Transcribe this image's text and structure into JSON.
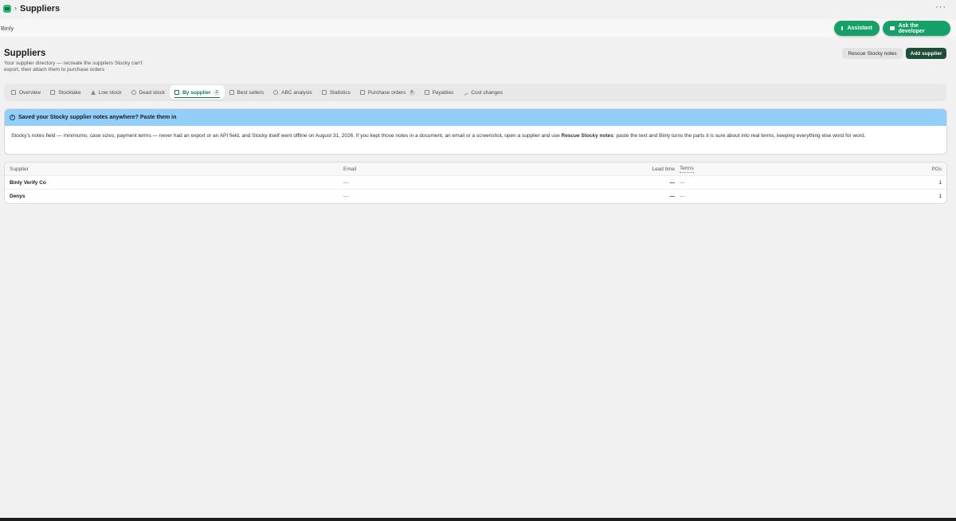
{
  "window": {
    "title": "Suppliers",
    "more_icon": "ellipsis-icon"
  },
  "appbar": {
    "app_name": "Binly",
    "assistant_label": "Assistant",
    "developer_label": "Ask the developer"
  },
  "page": {
    "title": "Suppliers",
    "subtitle": "Your supplier directory — recreate the suppliers Stocky can't export, then attach them to purchase orders",
    "secondary_action": "Rescue Stocky notes",
    "primary_action": "Add supplier"
  },
  "tabs": [
    {
      "label": "Overview",
      "icon": "grid-icon"
    },
    {
      "label": "Stocktake",
      "icon": "grid-icon"
    },
    {
      "label": "Low stock",
      "icon": "warning-icon"
    },
    {
      "label": "Dead stock",
      "icon": "clock-icon"
    },
    {
      "label": "By supplier",
      "icon": "store-icon",
      "badge": "2",
      "active": true
    },
    {
      "label": "Best sellers",
      "icon": "chart-icon"
    },
    {
      "label": "ABC analysis",
      "icon": "pie-icon"
    },
    {
      "label": "Statistics",
      "icon": "line-chart-icon"
    },
    {
      "label": "Purchase orders",
      "icon": "document-icon",
      "badge": "5"
    },
    {
      "label": "Payables",
      "icon": "wallet-icon"
    },
    {
      "label": "Cost changes",
      "icon": "trend-icon"
    }
  ],
  "callout": {
    "title": "Saved your Stocky supplier notes anywhere? Paste them in",
    "body_before": "Stocky's notes field — minimums, case sizes, payment terms — never had an export or an API field, and Stocky itself went offline on August 31, 2026. If you kept those notes in a document, an email or a screenshot, open a supplier and use ",
    "body_strong": "Rescue Stocky notes",
    "body_after": ": paste the text and Binly turns the parts it is sure about into real terms, keeping everything else word for word."
  },
  "table": {
    "headers": {
      "supplier": "Supplier",
      "email": "Email",
      "lead_time": "Lead time",
      "terms": "Terms",
      "pos": "POs"
    },
    "rows": [
      {
        "supplier": "Binly Verify Co",
        "email": "—",
        "lead_time": "—",
        "terms": "—",
        "pos": "1"
      },
      {
        "supplier": "Denys",
        "email": "—",
        "lead_time": "—",
        "terms": "—",
        "pos": "1"
      }
    ]
  },
  "colors": {
    "accent": "#16a067",
    "primary_dark": "#1f4d3a",
    "callout": "#93cef8"
  }
}
